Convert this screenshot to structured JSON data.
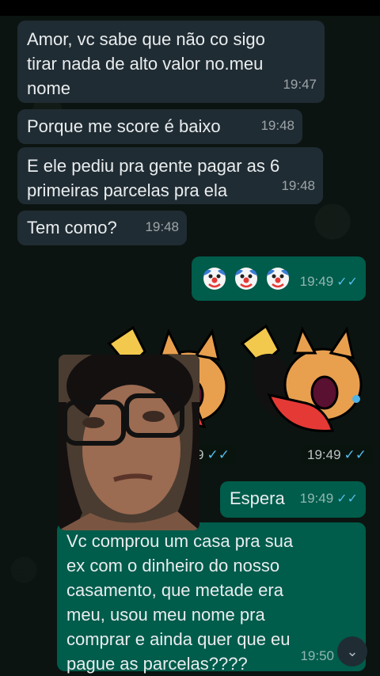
{
  "messages": {
    "m1": {
      "text_l1": "Amor, vc sabe que não co sigo",
      "text_l2": "tirar nada de alto valor no.meu",
      "text_l3": "nome",
      "time": "19:47"
    },
    "m2": {
      "text": "Porque me score é baixo",
      "time": "19:48"
    },
    "m3": {
      "text_l1": "E ele pediu pra gente pagar as 6",
      "text_l2": "primeiras parcelas pra ela",
      "time": "19:48"
    },
    "m4": {
      "text": "Tem como?",
      "time": "19:48"
    },
    "m5": {
      "emojis": [
        "clown-face",
        "clown-face",
        "clown-face"
      ],
      "time": "19:49"
    },
    "sticker1": {
      "time_partial": "9"
    },
    "sticker2": {
      "time": "19:49"
    },
    "m6": {
      "text": "Espera",
      "time": "19:49"
    },
    "m7": {
      "text_l1": "Vc comprou um casa pra sua",
      "text_l2": "ex com o dinheiro do nosso",
      "text_l3": "casamento,  que metade era",
      "text_l4": "meu, usou meu nome pra",
      "text_l5": "comprar e ainda quer que eu",
      "text_l6": "pague as parcelas????",
      "time": "19:50"
    }
  },
  "icons": {
    "read_ticks": "double-check-icon",
    "scroll_down": "chevrons-down-icon"
  },
  "colors": {
    "incoming": "#202c33",
    "outgoing": "#005c4b",
    "tick": "#53bdeb",
    "background": "#0b1410"
  }
}
